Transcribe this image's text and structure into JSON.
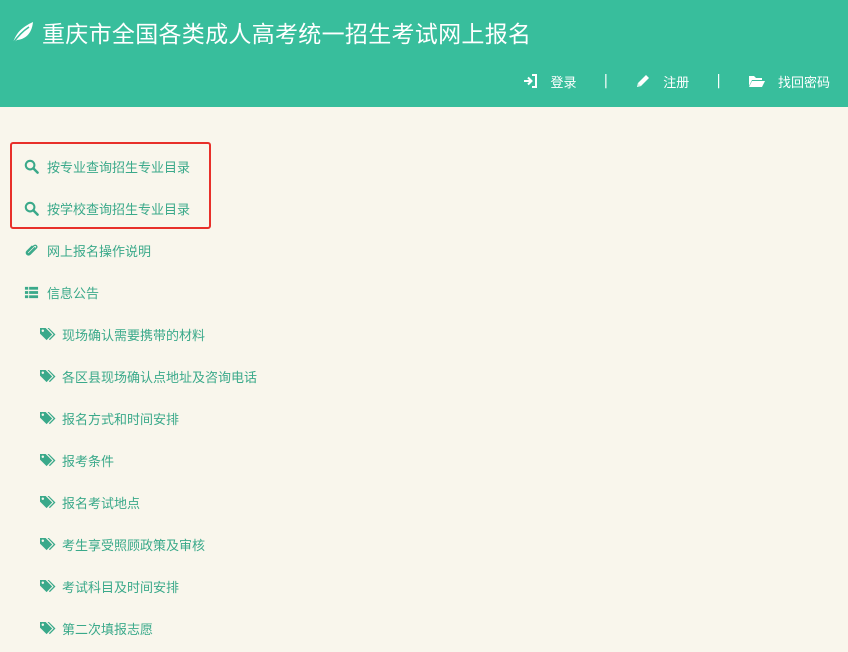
{
  "header": {
    "title": "重庆市全国各类成人高考统一招生考试网上报名",
    "logo_icon": "leaf-icon",
    "login_label": "登录",
    "register_label": "注册",
    "recover_label": "找回密码",
    "separator": "|"
  },
  "nav": {
    "items": [
      {
        "label": "按专业查询招生专业目录",
        "icon": "search-icon"
      },
      {
        "label": "按学校查询招生专业目录",
        "icon": "search-icon"
      },
      {
        "label": "网上报名操作说明",
        "icon": "paperclip-icon"
      },
      {
        "label": "信息公告",
        "icon": "list-icon"
      }
    ],
    "announcements": [
      {
        "label": "现场确认需要携带的材料",
        "icon": "tags-icon"
      },
      {
        "label": "各区县现场确认点地址及咨询电话",
        "icon": "tags-icon"
      },
      {
        "label": "报名方式和时间安排",
        "icon": "tags-icon"
      },
      {
        "label": "报考条件",
        "icon": "tags-icon"
      },
      {
        "label": "报名考试地点",
        "icon": "tags-icon"
      },
      {
        "label": "考生享受照顾政策及审核",
        "icon": "tags-icon"
      },
      {
        "label": "考试科目及时间安排",
        "icon": "tags-icon"
      },
      {
        "label": "第二次填报志愿",
        "icon": "tags-icon"
      }
    ]
  },
  "colors": {
    "header_bg": "#38be9c",
    "page_bg": "#f9f6ec",
    "link": "#3aa98a",
    "highlight_border": "#e8302a"
  }
}
